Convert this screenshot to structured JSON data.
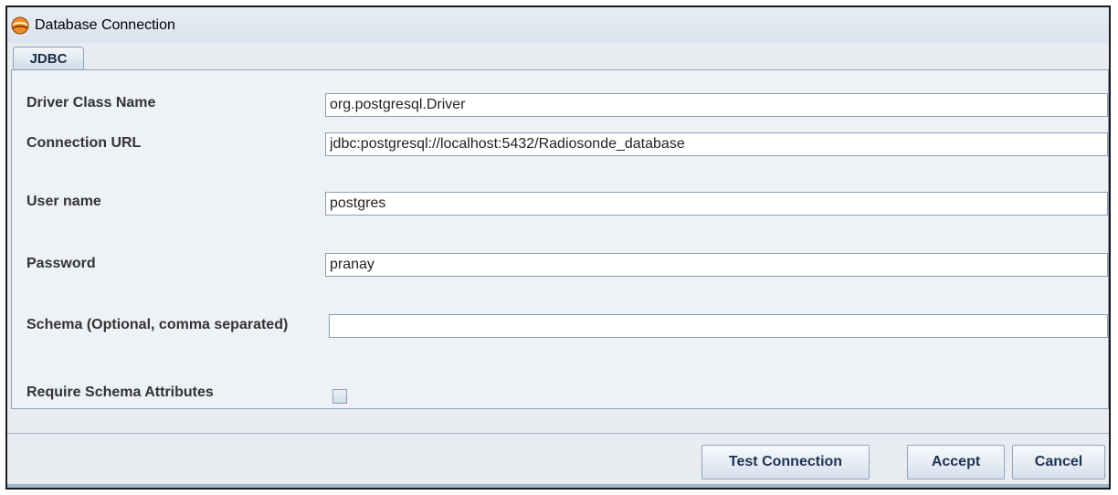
{
  "window": {
    "title": "Database Connection",
    "icon": "app-logo-icon"
  },
  "tabs": [
    {
      "label": "JDBC",
      "selected": true
    }
  ],
  "form": {
    "driver_class": {
      "label": "Driver Class Name",
      "value": "org.postgresql.Driver"
    },
    "connection_url": {
      "label": "Connection URL",
      "value": "jdbc:postgresql://localhost:5432/Radiosonde_database"
    },
    "user_name": {
      "label": "User name",
      "value": "postgres"
    },
    "password": {
      "label": "Password",
      "value": "pranay"
    },
    "schema": {
      "label": "Schema (Optional, comma separated)",
      "value": ""
    },
    "require_schema_attributes": {
      "label": "Require Schema Attributes",
      "checked": false
    }
  },
  "buttons": {
    "test_connection": "Test Connection",
    "accept": "Accept",
    "cancel": "Cancel"
  }
}
